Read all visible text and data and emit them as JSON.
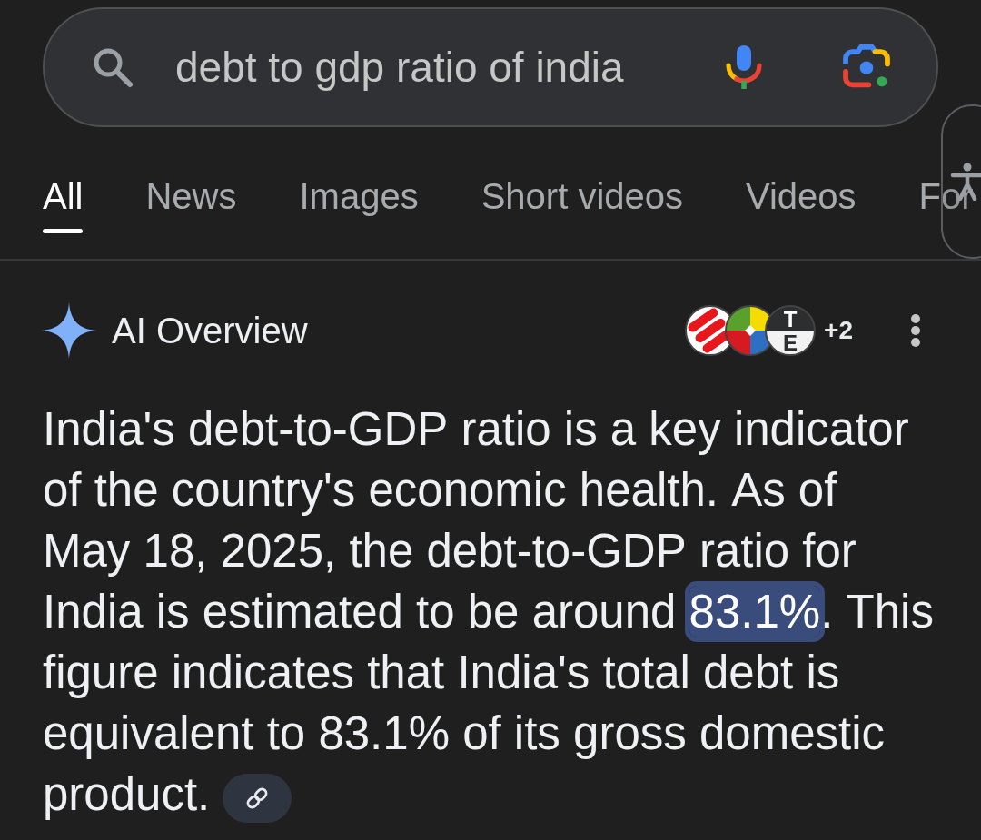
{
  "search": {
    "value": "debt to gdp ratio of india"
  },
  "tabs": [
    {
      "label": "All",
      "selected": true
    },
    {
      "label": "News",
      "selected": false
    },
    {
      "label": "Images",
      "selected": false
    },
    {
      "label": "Short videos",
      "selected": false
    },
    {
      "label": "Videos",
      "selected": false
    },
    {
      "label": "For",
      "selected": false
    }
  ],
  "overview": {
    "title": "AI Overview",
    "sources": [
      {
        "kind": "stripes"
      },
      {
        "kind": "wheel"
      },
      {
        "kind": "letters",
        "letters": [
          "T",
          "E"
        ]
      }
    ],
    "more_sources": "+2",
    "body": [
      {
        "text": "India's debt-to-GDP ratio is a key indicator of the country's economic health. As of May 18, 2025, the debt-to-GDP ratio for India is estimated to be around ",
        "highlighted": false
      },
      {
        "text": "83.1%",
        "highlighted": true
      },
      {
        "text": ". This figure indicates that India's total debt is equivalent to 83.1% of its gross domestic product.",
        "highlighted": false
      }
    ]
  }
}
